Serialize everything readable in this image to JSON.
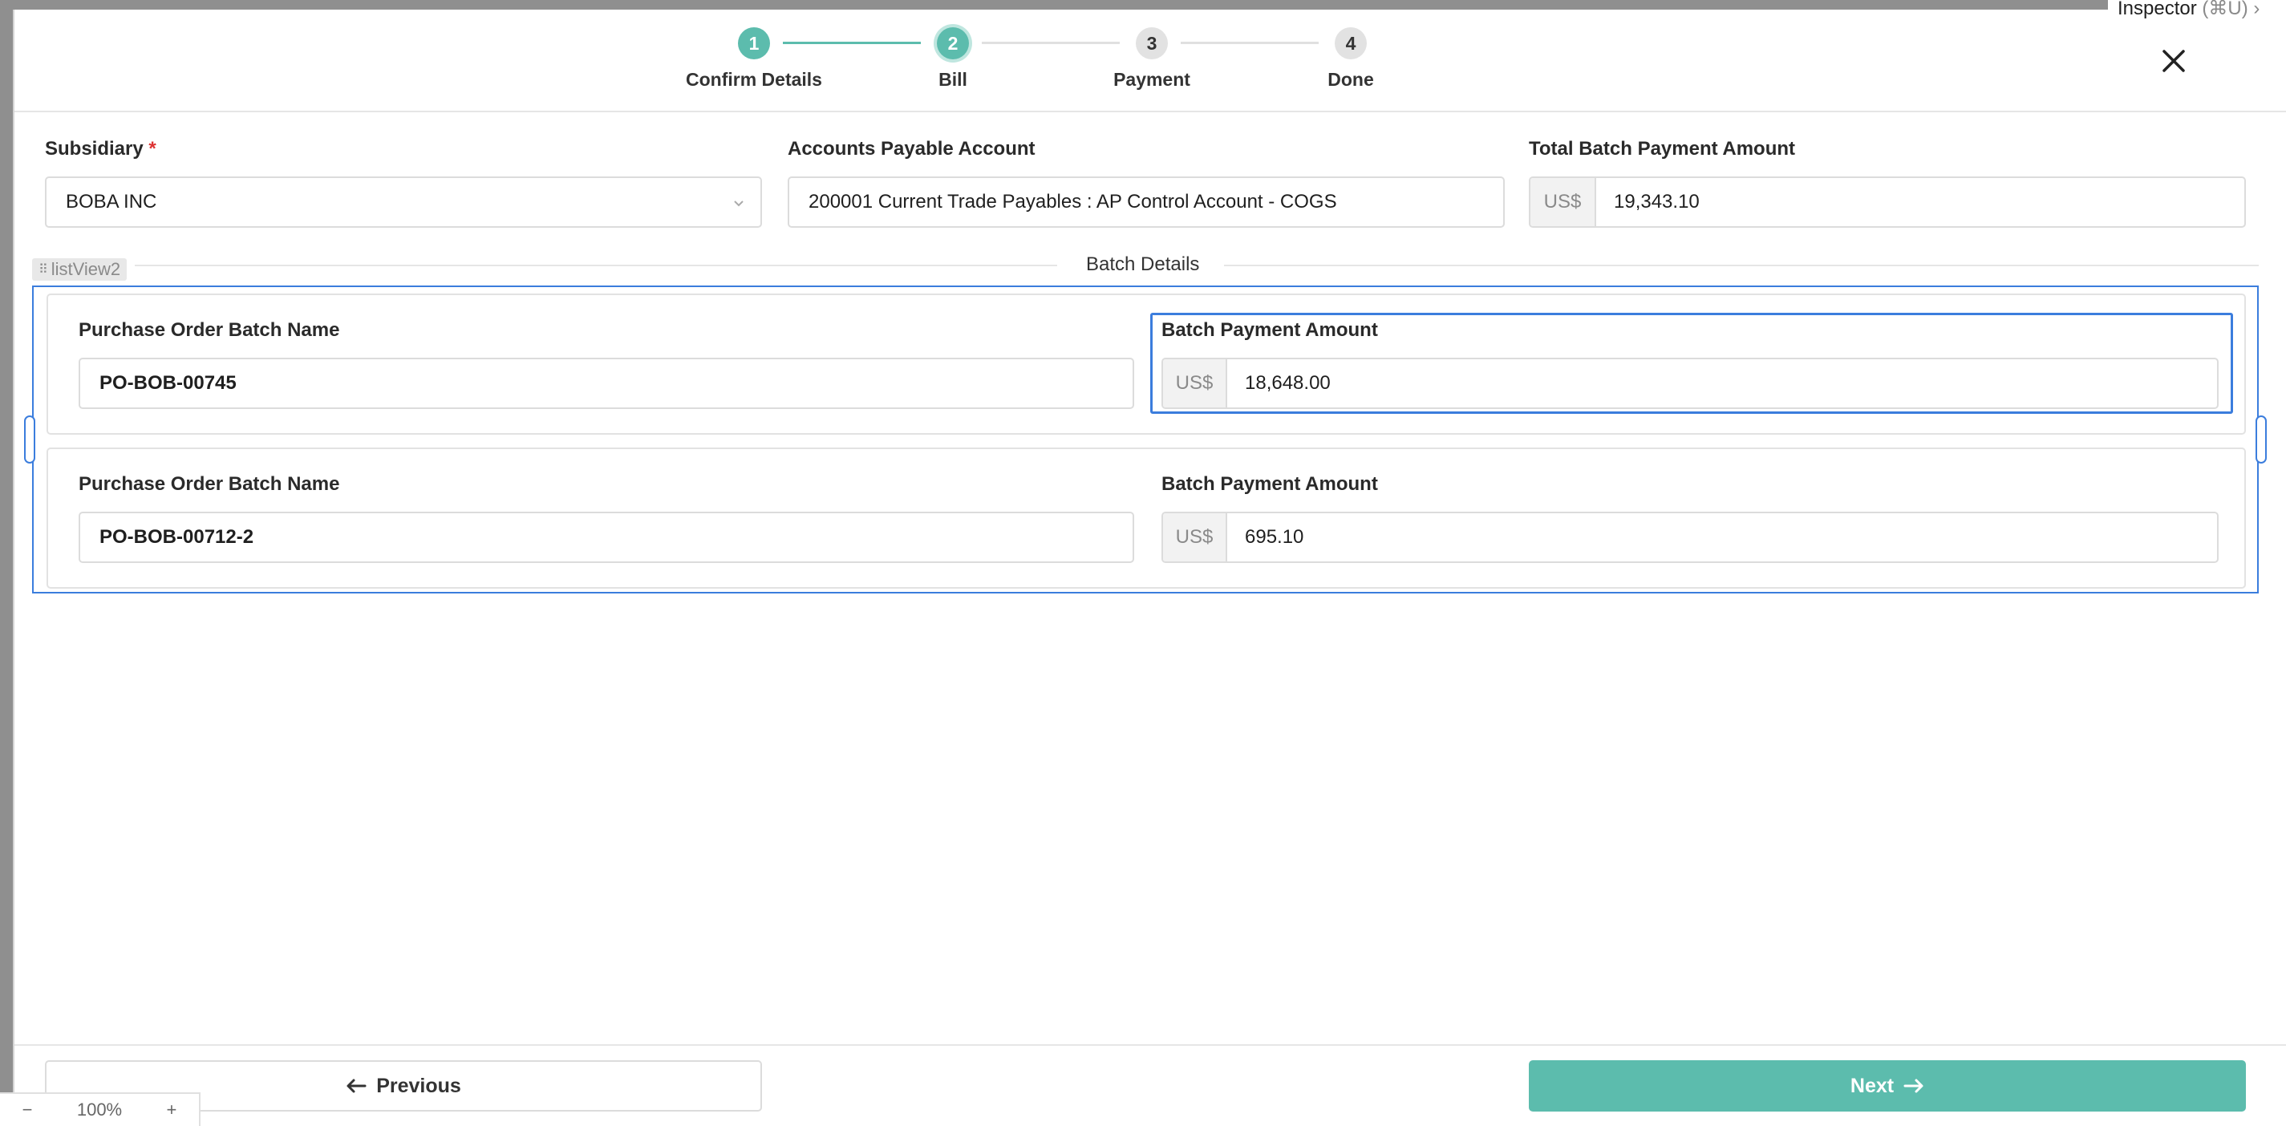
{
  "stepper": {
    "steps": [
      {
        "number": "1",
        "label": "Confirm Details",
        "state": "done"
      },
      {
        "number": "2",
        "label": "Bill",
        "state": "current"
      },
      {
        "number": "3",
        "label": "Payment",
        "state": "todo"
      },
      {
        "number": "4",
        "label": "Done",
        "state": "todo"
      }
    ]
  },
  "inspector": {
    "label": "Inspector",
    "shortcut": "(⌘U)"
  },
  "form": {
    "subsidiary": {
      "label": "Subsidiary",
      "required_mark": "*",
      "value": "BOBA INC"
    },
    "ap_account": {
      "label": "Accounts Payable Account",
      "value": "200001 Current Trade Payables : AP Control Account - COGS"
    },
    "total": {
      "label": "Total Batch Payment Amount",
      "currency": "US$",
      "value": "19,343.10"
    }
  },
  "batch_details": {
    "title": "Batch Details",
    "list_name": "listView2",
    "rows": [
      {
        "name_label": "Purchase Order Batch Name",
        "name_value": "PO-BOB-00745",
        "amount_label": "Batch Payment Amount",
        "currency": "US$",
        "amount_value": "18,648.00"
      },
      {
        "name_label": "Purchase Order Batch Name",
        "name_value": "PO-BOB-00712-2",
        "amount_label": "Batch Payment Amount",
        "currency": "US$",
        "amount_value": "695.10"
      }
    ]
  },
  "footer": {
    "previous_label": "Previous",
    "next_label": "Next"
  },
  "zoom": {
    "minus": "−",
    "level": "100%",
    "plus": "+"
  },
  "colors": {
    "accent": "#5cbcad",
    "selection": "#3b7ddd",
    "required": "#dd3333"
  }
}
